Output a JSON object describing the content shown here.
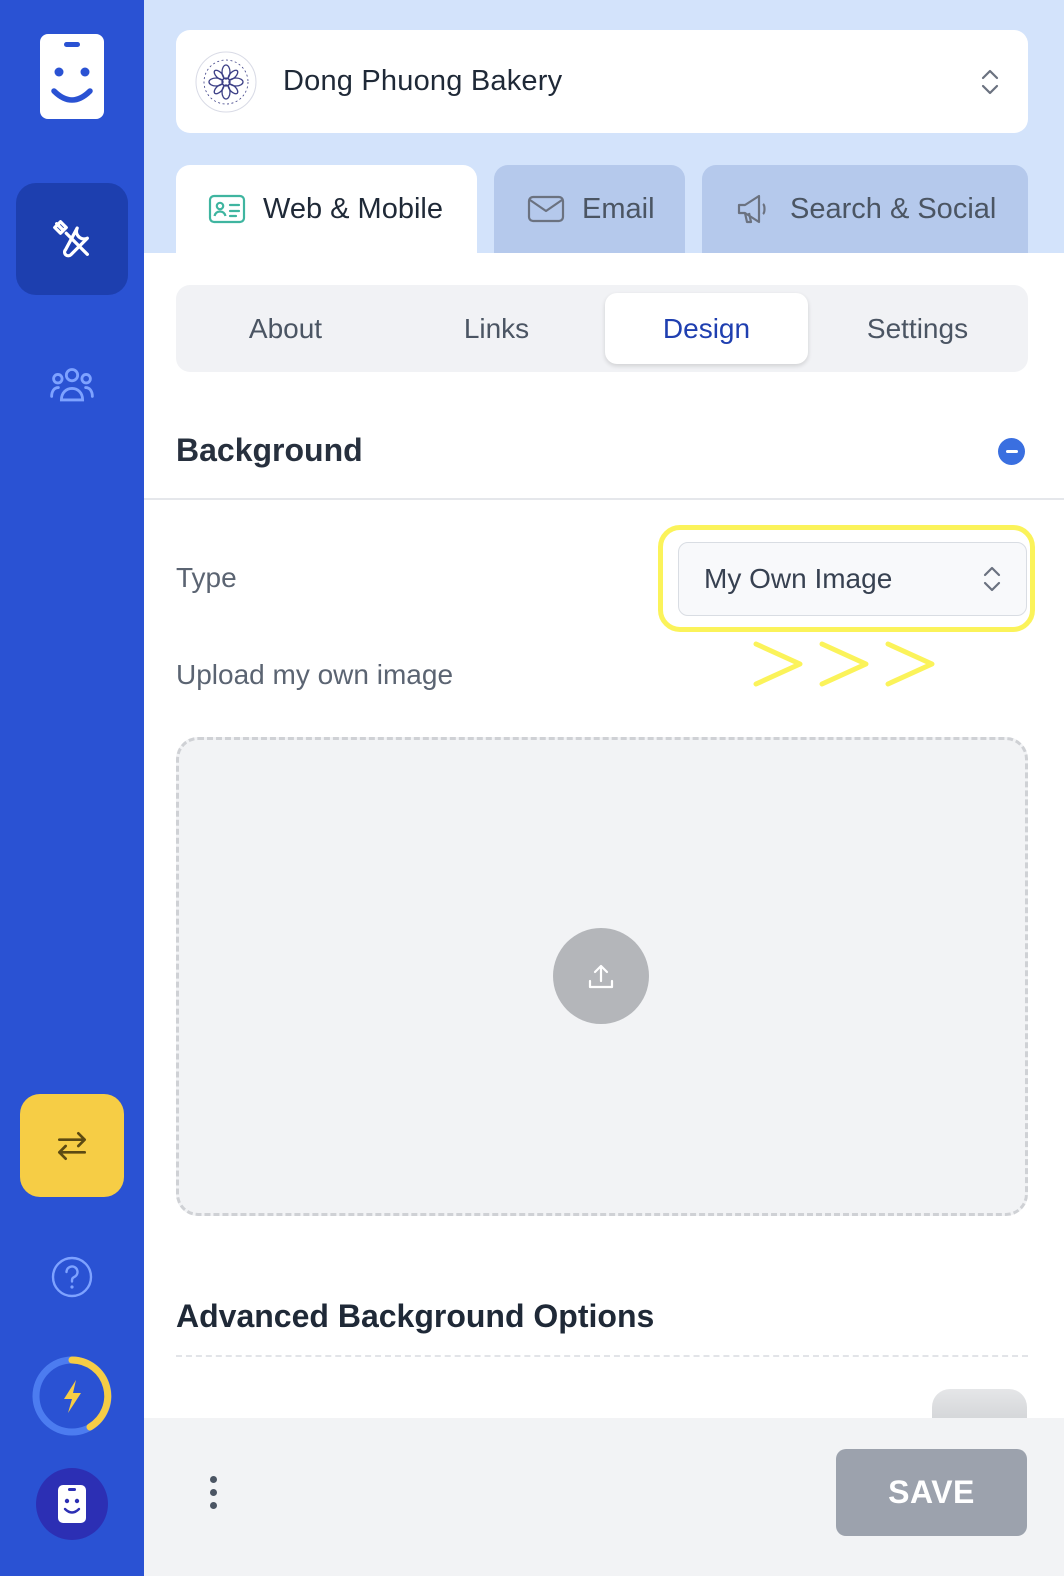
{
  "business": {
    "name": "Dong Phuong Bakery",
    "logo_text": "DONG PHUONG BAKERY · NOLA EAST 1982"
  },
  "channel_tabs": [
    {
      "label": "Web & Mobile",
      "icon": "id-card-icon",
      "active": true
    },
    {
      "label": "Email",
      "icon": "envelope-icon",
      "active": false
    },
    {
      "label": "Search & Social",
      "icon": "megaphone-icon",
      "active": false
    }
  ],
  "section_tabs": [
    {
      "label": "About",
      "active": false
    },
    {
      "label": "Links",
      "active": false
    },
    {
      "label": "Design",
      "active": true
    },
    {
      "label": "Settings",
      "active": false
    }
  ],
  "background": {
    "title": "Background",
    "type_label": "Type",
    "type_value": "My Own Image",
    "upload_label": "Upload my own image"
  },
  "advanced": {
    "title": "Advanced Background Options"
  },
  "footer": {
    "save_label": "SAVE"
  },
  "colors": {
    "sidebar": "#2a52d3",
    "accent_yellow": "#f6cd45",
    "active_tab_text": "#1f3fb0",
    "highlight": "#fbf35a",
    "save_disabled": "#9ca2ad"
  }
}
